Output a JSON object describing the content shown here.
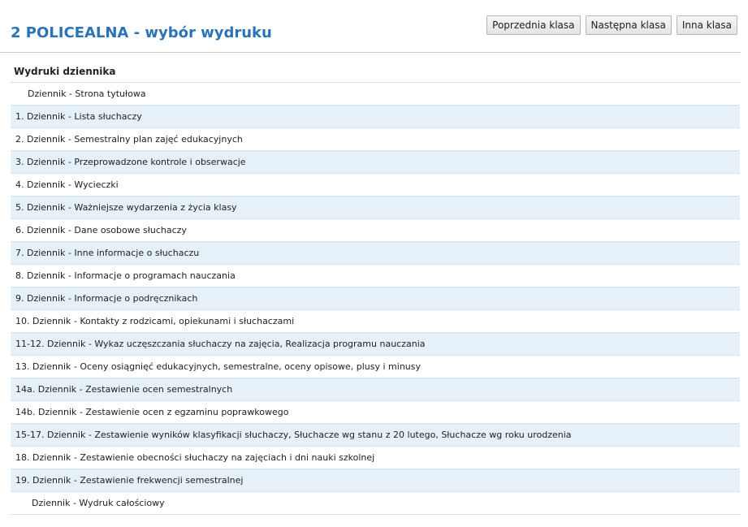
{
  "header": {
    "title": "2 POLICEALNA - wybór wydruku"
  },
  "toolbar": {
    "prev_label": "Poprzednia klasa",
    "next_label": "Następna klasa",
    "other_label": "Inna klasa"
  },
  "table": {
    "heading": "Wydruki dziennika",
    "rows": [
      {
        "label": "Dziennik - Strona tytułowa"
      },
      {
        "label": "1. Dziennik - Lista słuchaczy"
      },
      {
        "label": "2. Dziennik - Semestralny plan zajęć edukacyjnych"
      },
      {
        "label": "3. Dziennik - Przeprowadzone kontrole i obserwacje"
      },
      {
        "label": "4. Dziennik - Wycieczki"
      },
      {
        "label": "5. Dziennik - Ważniejsze wydarzenia z życia klasy"
      },
      {
        "label": "6. Dziennik - Dane osobowe słuchaczy"
      },
      {
        "label": "7. Dziennik - Inne informacje o słuchaczu"
      },
      {
        "label": "8. Dziennik - Informacje o programach nauczania"
      },
      {
        "label": "9. Dziennik - Informacje o podręcznikach"
      },
      {
        "label": "10. Dziennik - Kontakty z rodzicami, opiekunami i słuchaczami"
      },
      {
        "label": "11-12. Dziennik - Wykaz uczęszczania słuchaczy na zajęcia, Realizacja programu nauczania"
      },
      {
        "label": "13. Dziennik - Oceny osiągnięć edukacyjnych, semestralne, oceny opisowe, plusy i minusy"
      },
      {
        "label": "14a. Dziennik - Zestawienie ocen semestralnych"
      },
      {
        "label": "14b. Dziennik - Zestawienie ocen z egzaminu poprawkowego"
      },
      {
        "label": "15-17. Dziennik - Zestawienie wyników klasyfikacji słuchaczy, Słuchacze wg stanu z 20 lutego, Słuchacze wg roku urodzenia"
      },
      {
        "label": "18. Dziennik - Zestawienie obecności słuchaczy na zajęciach i dni nauki szkolnej"
      },
      {
        "label": "19. Dziennik - Zestawienie frekwencji semestralnej"
      },
      {
        "label": "Dziennik - Wydruk całościowy"
      }
    ]
  },
  "colors": {
    "title": "#2a73b6",
    "row_alt": "#e6f0f9",
    "row_border": "#d3e2ec"
  }
}
